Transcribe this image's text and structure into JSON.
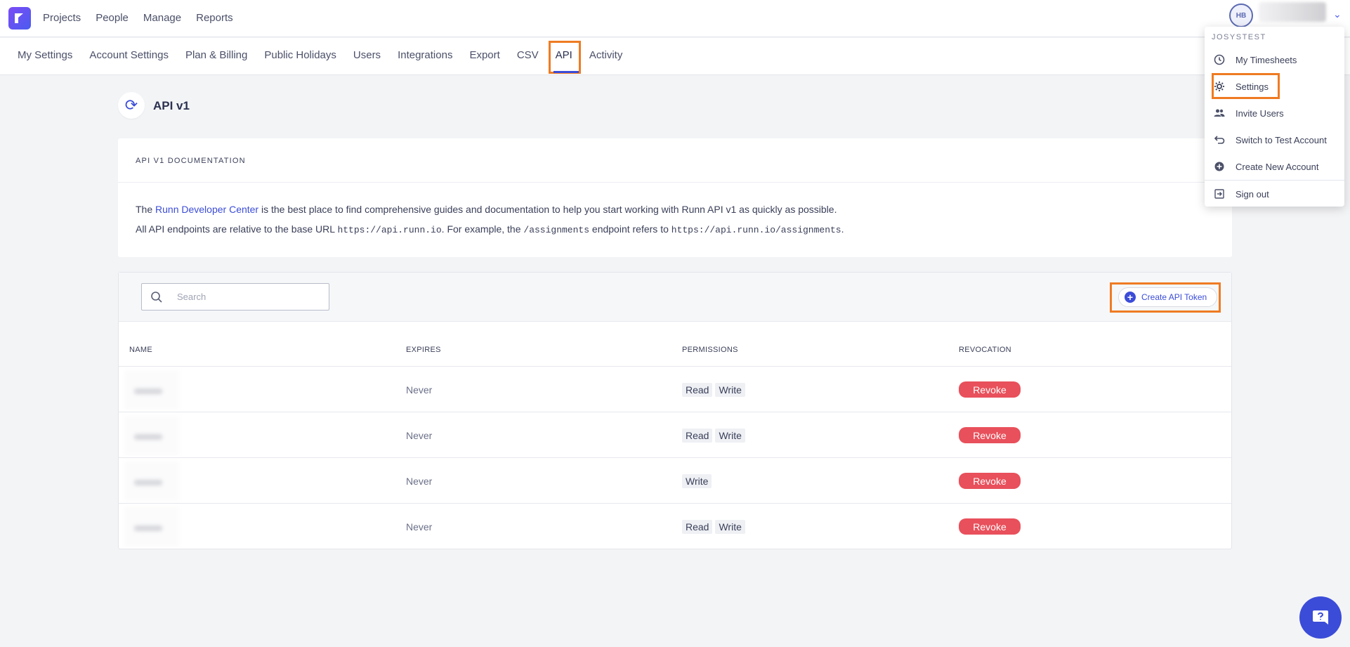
{
  "topnav": {
    "items": [
      "Projects",
      "People",
      "Manage",
      "Reports"
    ]
  },
  "user": {
    "initials": "HB"
  },
  "settings_tabs": [
    "My Settings",
    "Account Settings",
    "Plan & Billing",
    "Public Holidays",
    "Users",
    "Integrations",
    "Export",
    "CSV",
    "API",
    "Activity"
  ],
  "active_tab": "API",
  "page": {
    "title": "API v1"
  },
  "doc": {
    "heading": "API V1 DOCUMENTATION",
    "line1_pre": "The ",
    "line1_link": "Runn Developer Center",
    "line1_post": " is the best place to find comprehensive guides and documentation to help you start working with Runn API v1 as quickly as possible.",
    "line2_pre": "All API endpoints are relative to the base URL ",
    "base_url": "https://api.runn.io",
    "line2_mid": ". For example, the ",
    "endpoint": "/assignments",
    "line2_mid2": " endpoint refers to ",
    "full_url": "https://api.runn.io/assignments",
    "line2_end": "."
  },
  "search": {
    "placeholder": "Search"
  },
  "create_button": "Create API Token",
  "table": {
    "headers": [
      "NAME",
      "EXPIRES",
      "PERMISSIONS",
      "REVOCATION"
    ],
    "rows": [
      {
        "expires": "Never",
        "permissions": [
          "Read",
          "Write"
        ],
        "action": "Revoke"
      },
      {
        "expires": "Never",
        "permissions": [
          "Read",
          "Write"
        ],
        "action": "Revoke"
      },
      {
        "expires": "Never",
        "permissions": [
          "Write"
        ],
        "action": "Revoke"
      },
      {
        "expires": "Never",
        "permissions": [
          "Read",
          "Write"
        ],
        "action": "Revoke"
      }
    ]
  },
  "dropdown": {
    "account": "JOSYSTEST",
    "items": [
      {
        "label": "My Timesheets",
        "icon": "clock-icon"
      },
      {
        "label": "Settings",
        "icon": "gear-icon"
      },
      {
        "label": "Invite Users",
        "icon": "users-icon"
      },
      {
        "label": "Switch to Test Account",
        "icon": "switch-icon"
      },
      {
        "label": "Create New Account",
        "icon": "plus-circle-icon"
      },
      {
        "label": "Sign out",
        "icon": "sign-out-icon"
      }
    ]
  },
  "colors": {
    "accent": "#3b4cd8",
    "revoke": "#e8505b",
    "highlight": "#ef7b22"
  }
}
